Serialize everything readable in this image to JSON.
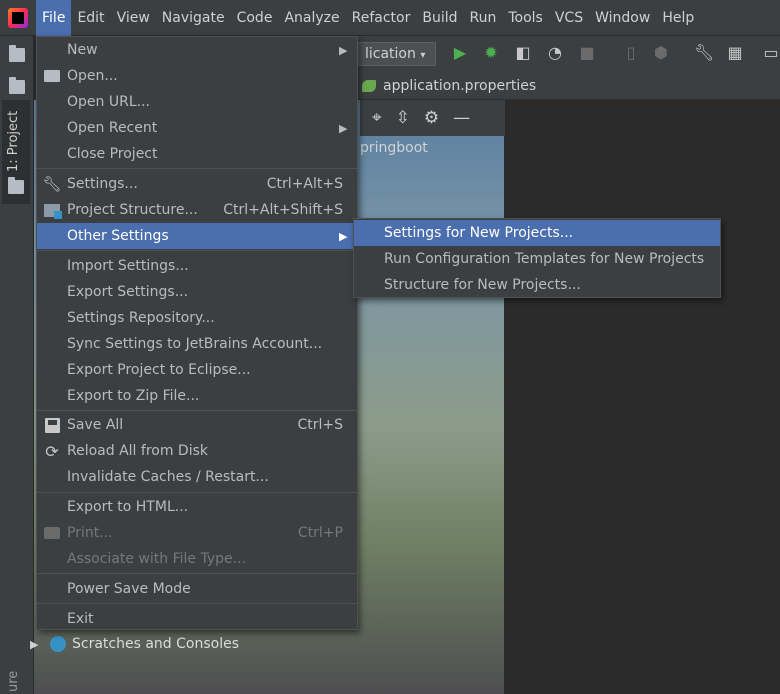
{
  "menubar": {
    "items": [
      "File",
      "Edit",
      "View",
      "Navigate",
      "Code",
      "Analyze",
      "Refactor",
      "Build",
      "Run",
      "Tools",
      "VCS",
      "Window",
      "Help"
    ],
    "active": "File"
  },
  "toolbar": {
    "run_config": "lication"
  },
  "editor": {
    "file_tab": "application.properties",
    "path_fragment": "pringboot"
  },
  "sidebar": {
    "project_tab": "1: Project",
    "structure_tab": "ure"
  },
  "project_tree": {
    "scratches": "Scratches and Consoles"
  },
  "file_menu": {
    "new": "New",
    "open": "Open...",
    "open_url": "Open URL...",
    "open_recent": "Open Recent",
    "close_project": "Close Project",
    "settings": "Settings...",
    "settings_shortcut": "Ctrl+Alt+S",
    "project_structure": "Project Structure...",
    "project_structure_shortcut": "Ctrl+Alt+Shift+S",
    "other_settings": "Other Settings",
    "import_settings": "Import Settings...",
    "export_settings": "Export Settings...",
    "settings_repository": "Settings Repository...",
    "sync_settings": "Sync Settings to JetBrains Account...",
    "export_eclipse": "Export Project to Eclipse...",
    "export_zip": "Export to Zip File...",
    "save_all": "Save All",
    "save_all_shortcut": "Ctrl+S",
    "reload": "Reload All from Disk",
    "invalidate": "Invalidate Caches / Restart...",
    "export_html": "Export to HTML...",
    "print": "Print...",
    "print_shortcut": "Ctrl+P",
    "associate": "Associate with File Type...",
    "power_save": "Power Save Mode",
    "exit": "Exit"
  },
  "other_settings_submenu": {
    "settings_new_projects": "Settings for New Projects...",
    "run_config_templates": "Run Configuration Templates for New Projects",
    "structure_new_projects": "Structure for New Projects..."
  },
  "colors": {
    "menu_bg": "#3c3f41",
    "selection": "#4b6eaf",
    "run_green": "#4caf50",
    "debug_green": "#4caf50"
  }
}
